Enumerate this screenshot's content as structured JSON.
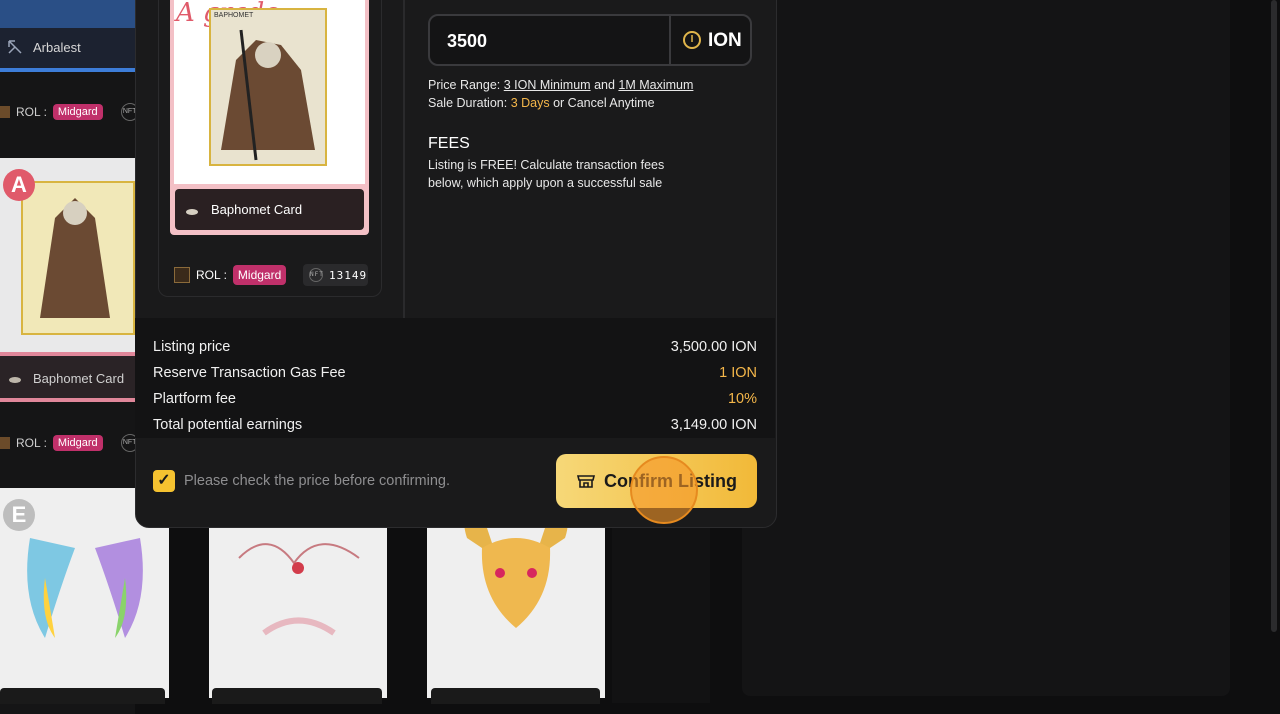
{
  "background_list": {
    "arbalest_label": "Arbalest",
    "rol_label": "ROL :",
    "realm": "Midgard",
    "baphomet_label": "Baphomet Card",
    "grade_a": "A",
    "grade_e": "E",
    "nft_badge": "NFT"
  },
  "card_preview": {
    "card_title": "BAPHOMET",
    "grade_text": "A grade",
    "name": "Baphomet Card",
    "rol_label": "ROL :",
    "realm": "Midgard",
    "token_id": "13149",
    "nft_badge": "NFT"
  },
  "price_input": {
    "value": "3500",
    "currency": "ION"
  },
  "price_info": {
    "range_prefix": "Price Range:",
    "min": "3 ION Minimum",
    "and": "and",
    "max": "1M Maximum",
    "duration_prefix": "Sale Duration:",
    "duration": "3 Days",
    "duration_suffix": "or Cancel Anytime"
  },
  "fees": {
    "title": "FEES",
    "line1": "Listing is FREE! Calculate transaction fees",
    "line2": "below, which apply upon a successful sale"
  },
  "summary": {
    "rows": [
      {
        "label": "Listing price",
        "value": "3,500.00 ION",
        "highlight": false
      },
      {
        "label": "Reserve Transaction Gas Fee",
        "value": "1 ION",
        "highlight": true
      },
      {
        "label": "Plartform fee",
        "value": "10%",
        "highlight": true
      },
      {
        "label": "Total potential earnings",
        "value": "3,149.00 ION",
        "highlight": false
      }
    ]
  },
  "confirm": {
    "checkbox_label": "Please check the price before confirming.",
    "button_label": "Confirm Listing",
    "checked": true
  },
  "colors": {
    "accent_gold": "#f5b74a",
    "button_gradient_start": "#f6d878",
    "button_gradient_end": "#f2b938",
    "realm_pink": "#c0306a"
  }
}
